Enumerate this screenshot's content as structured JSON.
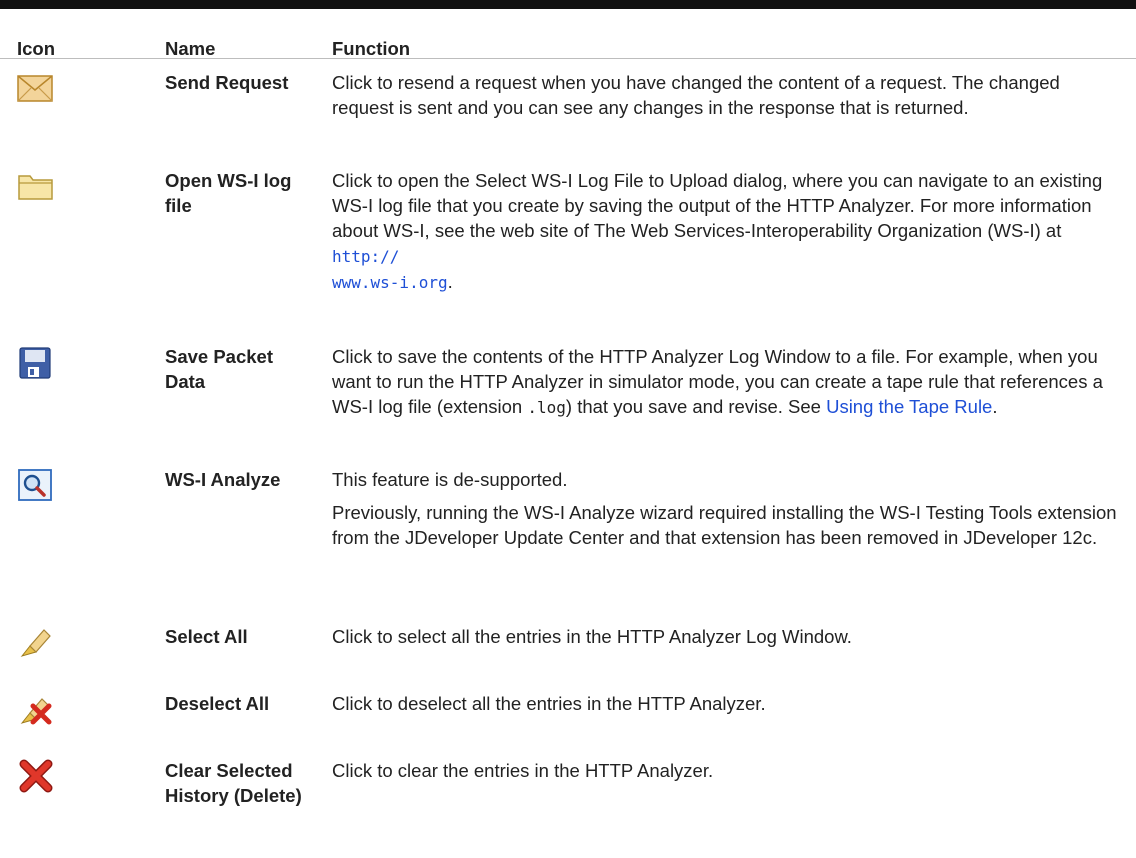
{
  "headers": {
    "icon": "Icon",
    "name": "Name",
    "function": "Function"
  },
  "rows": [
    {
      "icon": "envelope-icon",
      "name": "Send Request",
      "function_text": "Click to resend a request when you have changed the content of a request. The changed request is sent and you can see any changes in the response that is returned."
    },
    {
      "icon": "folder-icon",
      "name": "Open WS-I log file",
      "function_text": "Click to open the Select WS-I Log File to Upload dialog, where you can navigate to an existing WS-I log file that you create by saving the output of the HTTP Analyzer. For more information about WS-I, see the web site of The Web Services-Interoperability Organization (WS-I) at ",
      "link_1": "http://",
      "link_2": "www.ws-i.org",
      "after_link": "."
    },
    {
      "icon": "save-disk-icon",
      "name": "Save Packet Data",
      "function_text": "Click to save the contents of the HTTP Analyzer Log Window to a file. For example, when you want to run the HTTP Analyzer in simulator mode, you can create a tape rule that references a WS-I log file (extension ",
      "code": ".log",
      "function_text_2": ") that you save and revise. See ",
      "link": "Using the Tape Rule",
      "after_link": "."
    },
    {
      "icon": "magnifier-icon",
      "name": "WS-I Analyze",
      "function_text": "This feature is de-supported.",
      "function_text_2": "Previously, running the WS-I Analyze wizard required installing the WS-I Testing Tools extension from the JDeveloper Update Center and that extension has been removed in JDeveloper 12c."
    },
    {
      "icon": "select-all-brush-icon",
      "name": "Select All",
      "function_text": "Click to select all the entries in the HTTP Analyzer Log Window."
    },
    {
      "icon": "deselect-all-icon",
      "name": "Deselect All",
      "function_text": "Click to deselect all the entries in the HTTP Analyzer."
    },
    {
      "icon": "red-x-icon",
      "name": "Clear Selected History (Delete)",
      "function_text": "Click to clear the entries in the HTTP Analyzer."
    }
  ],
  "colors": {
    "link": "#1e4fd6",
    "rule": "#111111"
  }
}
